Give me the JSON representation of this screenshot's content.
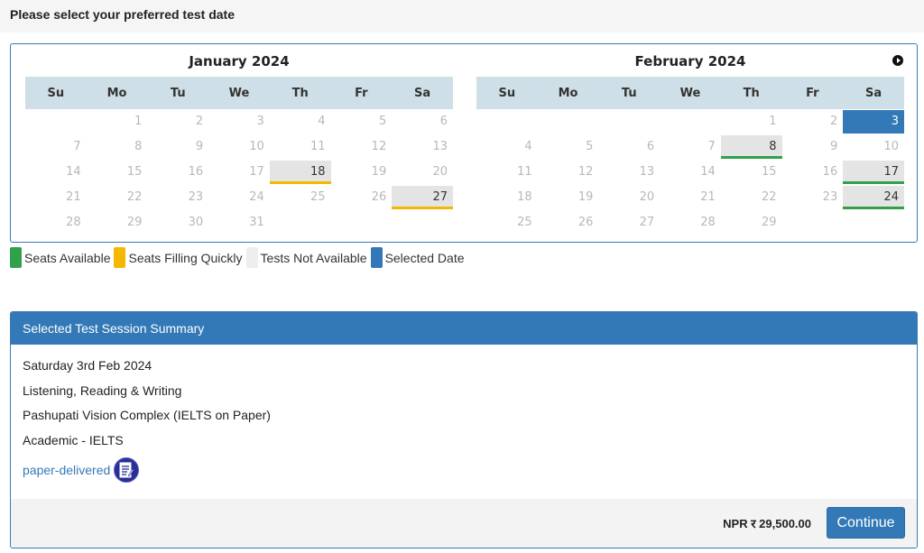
{
  "header": {
    "title": "Please select your preferred test date"
  },
  "weekdays": [
    "Su",
    "Mo",
    "Tu",
    "We",
    "Th",
    "Fr",
    "Sa"
  ],
  "calendars": [
    {
      "title": "January 2024",
      "weeks": [
        [
          {
            "d": ""
          },
          {
            "d": "1"
          },
          {
            "d": "2"
          },
          {
            "d": "3"
          },
          {
            "d": "4"
          },
          {
            "d": "5"
          },
          {
            "d": "6"
          }
        ],
        [
          {
            "d": "7"
          },
          {
            "d": "8"
          },
          {
            "d": "9"
          },
          {
            "d": "10"
          },
          {
            "d": "11"
          },
          {
            "d": "12"
          },
          {
            "d": "13"
          }
        ],
        [
          {
            "d": "14"
          },
          {
            "d": "15"
          },
          {
            "d": "16"
          },
          {
            "d": "17"
          },
          {
            "d": "18",
            "s": "filling"
          },
          {
            "d": "19"
          },
          {
            "d": "20"
          }
        ],
        [
          {
            "d": "21"
          },
          {
            "d": "22"
          },
          {
            "d": "23"
          },
          {
            "d": "24"
          },
          {
            "d": "25"
          },
          {
            "d": "26"
          },
          {
            "d": "27",
            "s": "filling"
          }
        ],
        [
          {
            "d": "28"
          },
          {
            "d": "29"
          },
          {
            "d": "30"
          },
          {
            "d": "31"
          },
          {
            "d": ""
          },
          {
            "d": ""
          },
          {
            "d": ""
          }
        ]
      ]
    },
    {
      "title": "February 2024",
      "weeks": [
        [
          {
            "d": ""
          },
          {
            "d": ""
          },
          {
            "d": ""
          },
          {
            "d": ""
          },
          {
            "d": "1"
          },
          {
            "d": "2"
          },
          {
            "d": "3",
            "s": "selected"
          }
        ],
        [
          {
            "d": "4"
          },
          {
            "d": "5"
          },
          {
            "d": "6"
          },
          {
            "d": "7"
          },
          {
            "d": "8",
            "s": "avail"
          },
          {
            "d": "9"
          },
          {
            "d": "10"
          }
        ],
        [
          {
            "d": "11"
          },
          {
            "d": "12"
          },
          {
            "d": "13"
          },
          {
            "d": "14"
          },
          {
            "d": "15"
          },
          {
            "d": "16"
          },
          {
            "d": "17",
            "s": "avail"
          }
        ],
        [
          {
            "d": "18"
          },
          {
            "d": "19"
          },
          {
            "d": "20"
          },
          {
            "d": "21"
          },
          {
            "d": "22"
          },
          {
            "d": "23"
          },
          {
            "d": "24",
            "s": "avail"
          }
        ],
        [
          {
            "d": "25"
          },
          {
            "d": "26"
          },
          {
            "d": "27"
          },
          {
            "d": "28"
          },
          {
            "d": "29"
          },
          {
            "d": ""
          },
          {
            "d": ""
          }
        ]
      ]
    }
  ],
  "legend": [
    {
      "label": "Seats Available",
      "color": "#2fa14a"
    },
    {
      "label": "Seats Filling Quickly",
      "color": "#f5b800"
    },
    {
      "label": "Tests Not Available",
      "color": "#eeeeee"
    },
    {
      "label": "Selected Date",
      "color": "#3379b7"
    }
  ],
  "summary": {
    "title": "Selected Test Session Summary",
    "date": "Saturday 3rd Feb 2024",
    "modules": "Listening, Reading & Writing",
    "venue": "Pashupati Vision Complex (IELTS on Paper)",
    "test_type": "Academic - IELTS",
    "delivery_link": "paper-delivered",
    "delivery_icon": "paper-document-icon",
    "price": "NPR र 29,500.00",
    "continue_label": "Continue"
  }
}
